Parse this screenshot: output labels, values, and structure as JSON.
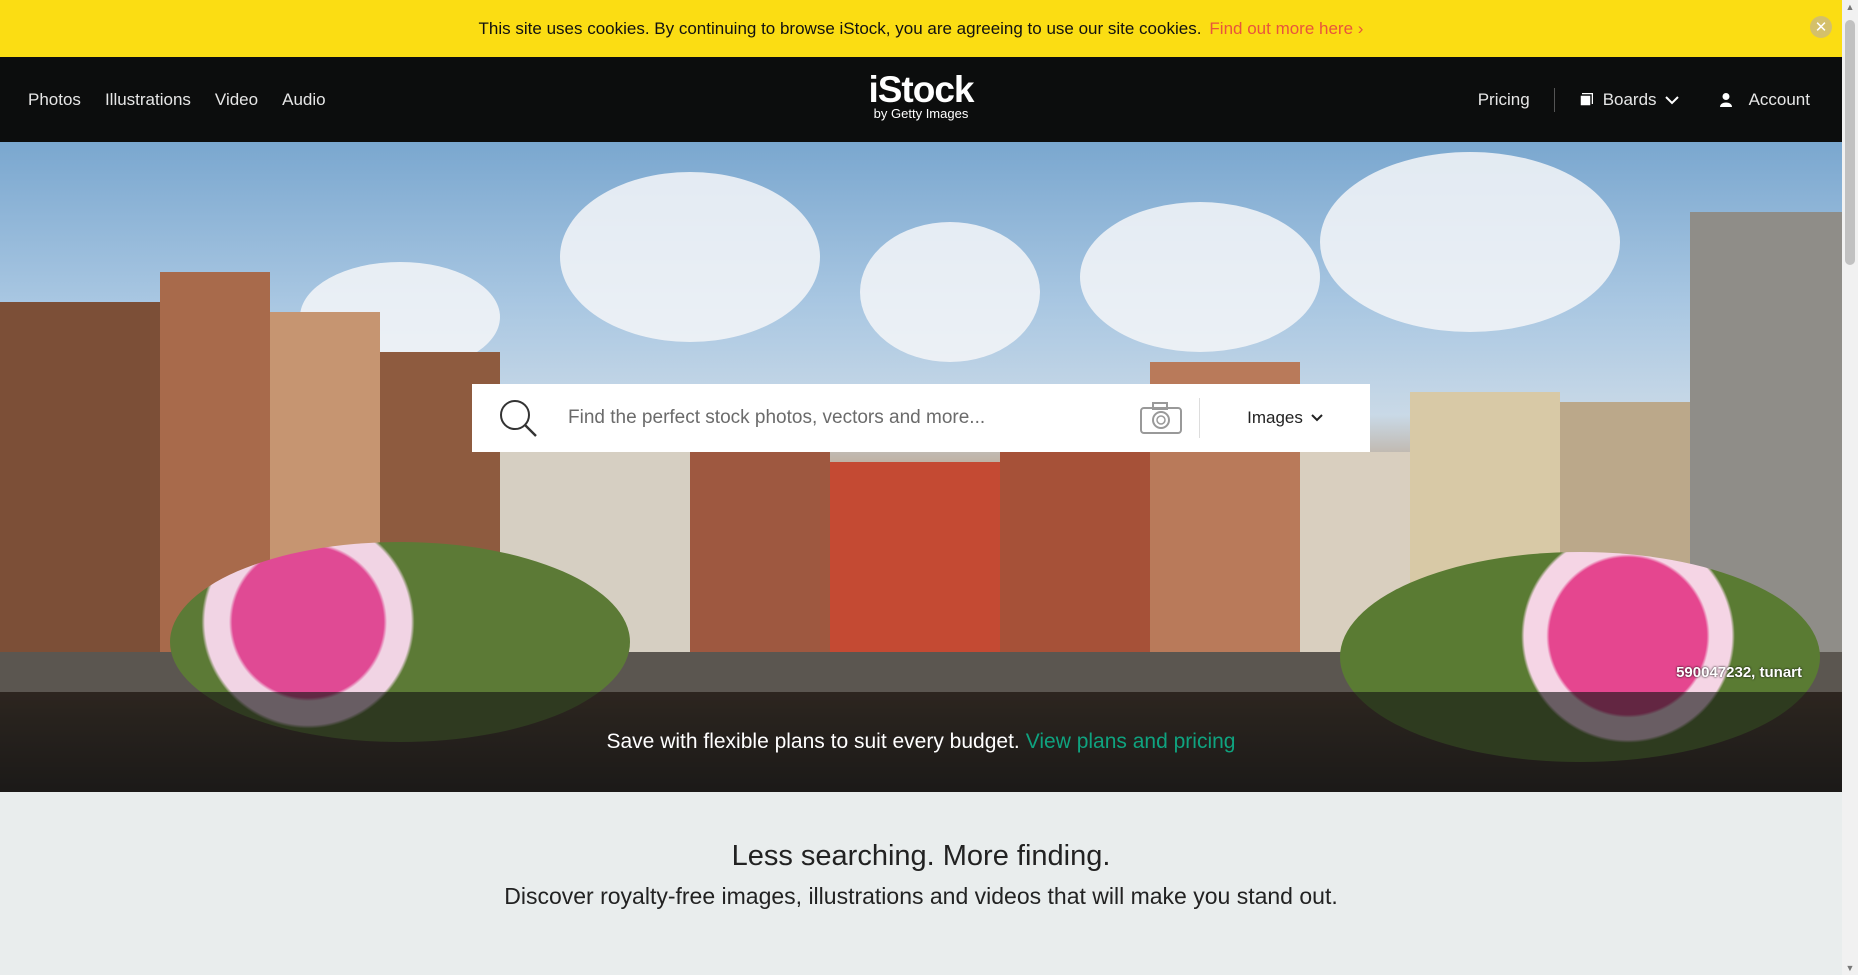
{
  "cookie_banner": {
    "text": "This site uses cookies. By continuing to browse iStock, you are agreeing to use our site cookies.",
    "link": "Find out more here ›",
    "close_icon": "close-icon"
  },
  "header": {
    "nav_left": [
      "Photos",
      "Illustrations",
      "Video",
      "Audio"
    ],
    "logo_main": "iStock",
    "logo_sub": "by Getty Images",
    "pricing": "Pricing",
    "boards": "Boards",
    "account": "Account"
  },
  "search": {
    "placeholder": "Find the perfect stock photos, vectors and more...",
    "type_selected": "Images"
  },
  "hero": {
    "credit": "590047232, tunart",
    "promo_text": "Save with flexible plans to suit every budget.",
    "promo_link": "View plans and pricing"
  },
  "lower": {
    "heading": "Less searching. More finding.",
    "subheading": "Discover royalty-free images, illustrations and videos that will make you stand out."
  },
  "colors": {
    "banner": "#fbdd13",
    "header_bg": "#0c0d0d",
    "link_red": "#e8553c",
    "link_green": "#0fa37f"
  }
}
